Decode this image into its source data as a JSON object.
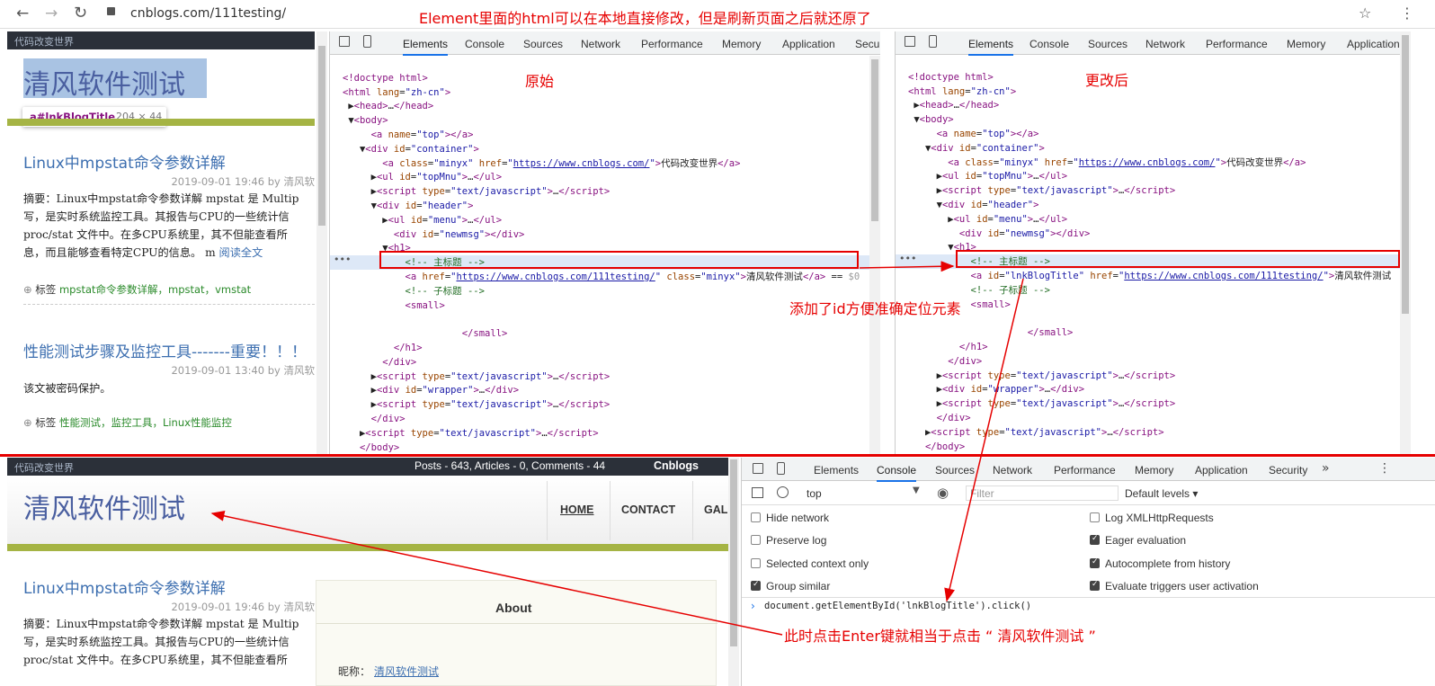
{
  "browser": {
    "url": "cnblogs.com/111testing/"
  },
  "annotations": {
    "top": "Element里面的html可以在本地直接修改，但是刷新页面之后就还原了",
    "original": "原始",
    "changed": "更改后",
    "added_id": "添加了id方便准确定位元素",
    "enter": "此时点击Enter键就相当于点击 “ 清风软件测试 ”"
  },
  "blog": {
    "top_bar": "代码改变世界",
    "title": "清风软件测试",
    "tooltip_sel": "a#lnkBlogTitle",
    "tooltip_size": "204 × 44",
    "stats": "Posts - 643, Articles - 0, Comments - 44",
    "brand": "Cnblogs",
    "nav": [
      "HOME",
      "CONTACT",
      "GAL"
    ],
    "posts": [
      {
        "title": "Linux中mpstat命令参数详解",
        "date": "2019-09-01 19:46 by 清风软",
        "lines": [
          "摘要：Linux中mpstat命令参数详解 mpstat 是 Multip",
          "写，是实时系统监控工具。其报告与CPU的一些统计信",
          "proc/stat 文件中。在多CPU系统里，其不但能查看所",
          "息，而且能够查看特定CPU的信息。 m "
        ],
        "more": "阅读全文",
        "tags_label": "标签",
        "tags": "mpstat命令参数详解，mpstat，vmstat"
      },
      {
        "title": "性能测试步骤及监控工具-------重要！！！",
        "date": "2019-09-01 13:40 by 清风软",
        "lines": [
          "该文被密码保护。"
        ],
        "tags_label": "标签",
        "tags": "性能测试，监控工具，Linux性能监控"
      }
    ],
    "about_title": "About",
    "nick_label": "昵称：",
    "nick": "清风软件测试"
  },
  "devtools": {
    "tabs": [
      "Elements",
      "Console",
      "Sources",
      "Network",
      "Performance",
      "Memory",
      "Application",
      "Security"
    ],
    "tabs_right": [
      "Elements",
      "Console",
      "Sources",
      "Network",
      "Performance",
      "Memory",
      "Application"
    ],
    "console_tabs": [
      "Elements",
      "Console",
      "Sources",
      "Network",
      "Performance",
      "Memory",
      "Application",
      "Security"
    ],
    "context": "top",
    "filter_placeholder": "Filter",
    "levels": "Default levels ▾",
    "options_left": [
      {
        "label": "Hide network",
        "on": false
      },
      {
        "label": "Preserve log",
        "on": false
      },
      {
        "label": "Selected context only",
        "on": false
      },
      {
        "label": "Group similar",
        "on": true
      }
    ],
    "options_right": [
      {
        "label": "Log XMLHttpRequests",
        "on": false
      },
      {
        "label": "Eager evaluation",
        "on": true
      },
      {
        "label": "Autocomplete from history",
        "on": true
      },
      {
        "label": "Evaluate triggers user activation",
        "on": true
      }
    ],
    "command": "document.getElementById('lnkBlogTitle').click()"
  }
}
